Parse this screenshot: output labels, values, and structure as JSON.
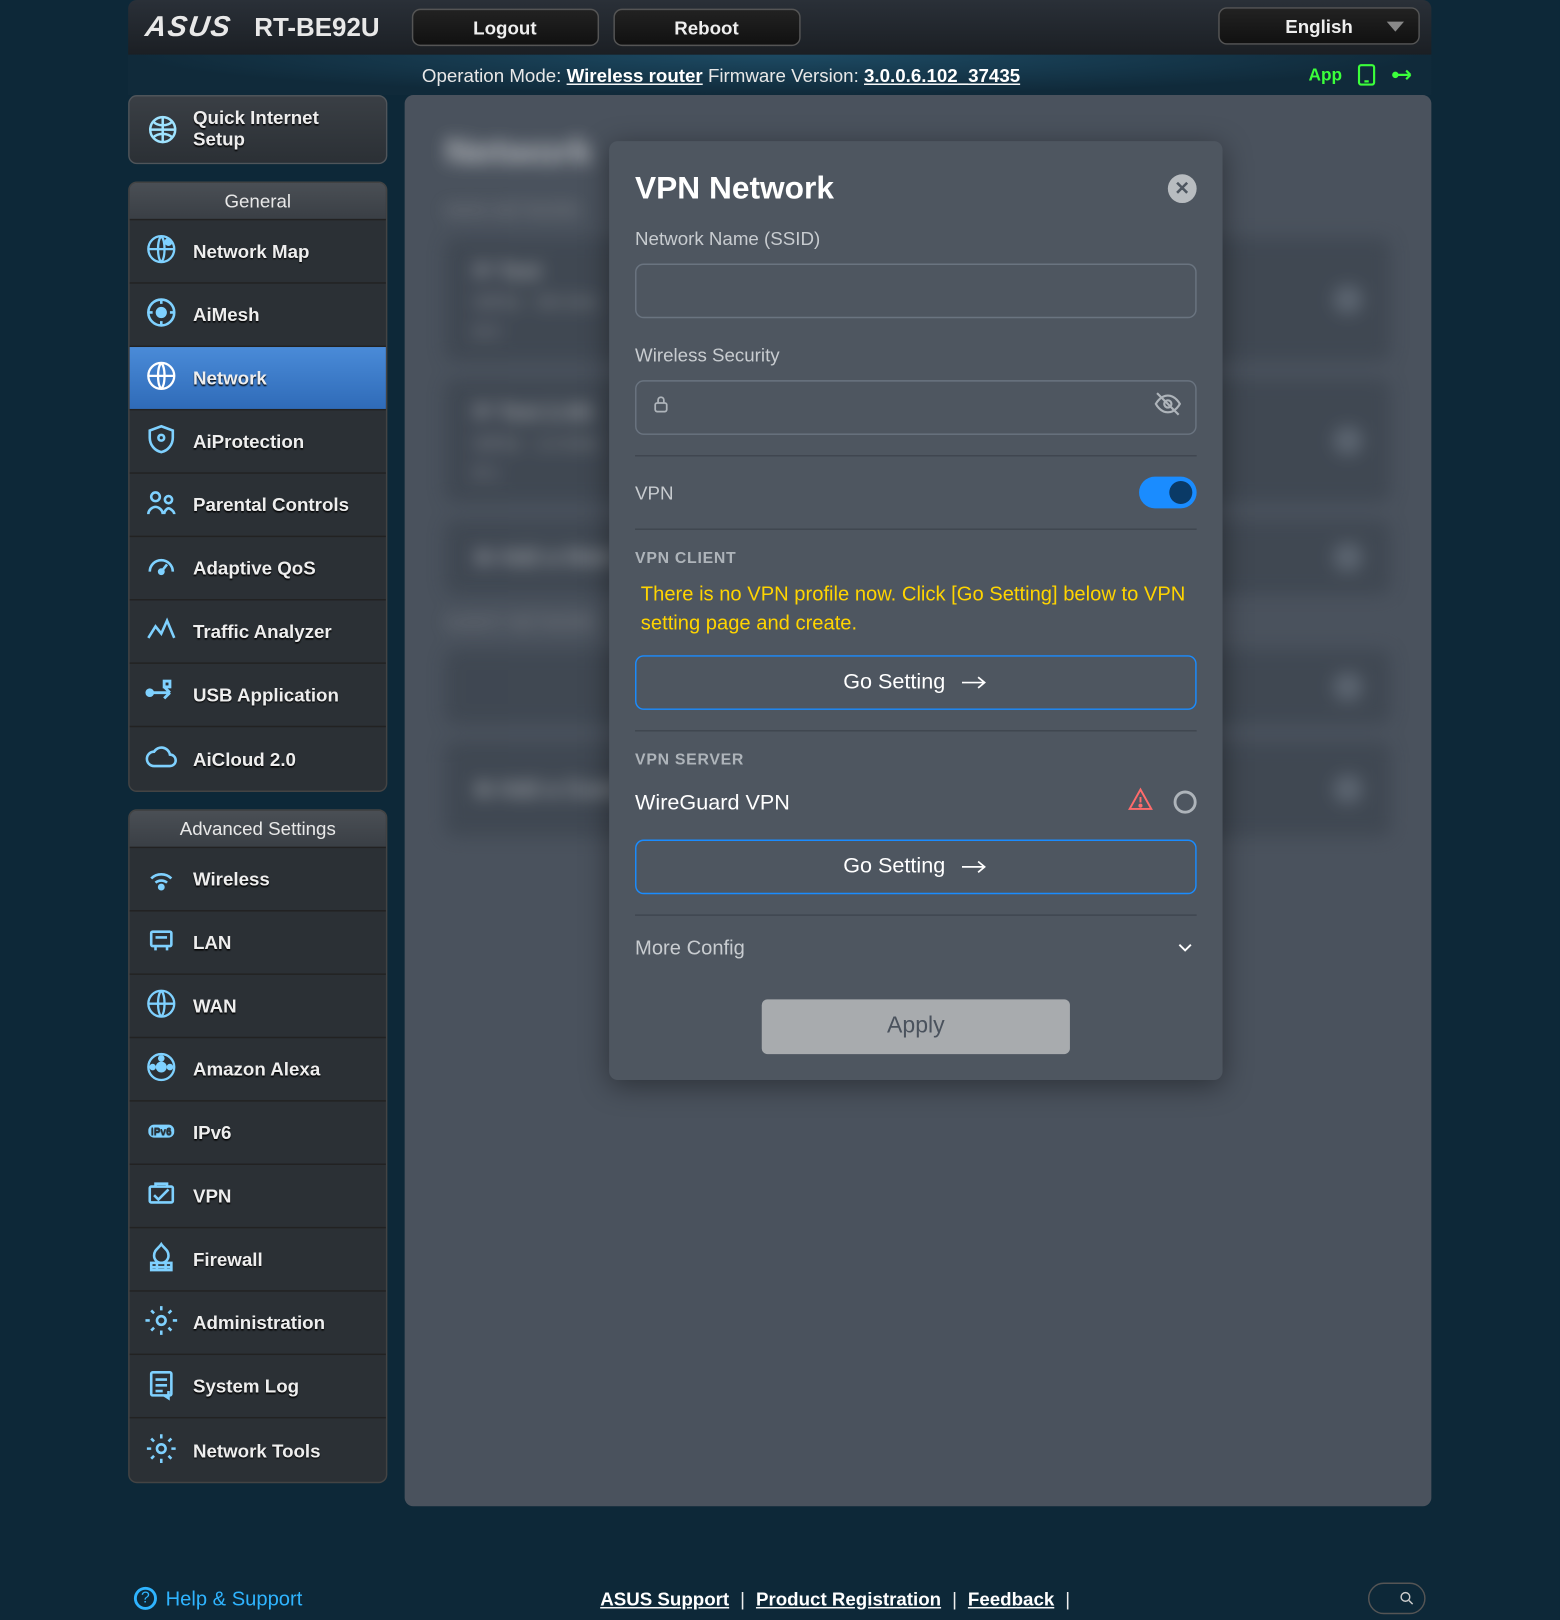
{
  "brand": {
    "vendor": "ASUS",
    "model": "RT-BE92U"
  },
  "top": {
    "logout": "Logout",
    "reboot": "Reboot",
    "language": "English"
  },
  "status": {
    "op_label": "Operation Mode:",
    "op_value": "Wireless router",
    "fw_label": "Firmware Version:",
    "fw_value": "3.0.0.6.102_37435",
    "app": "App"
  },
  "quick_setup": "Quick Internet Setup",
  "general_header": "General",
  "general_items": [
    {
      "label": "Network Map"
    },
    {
      "label": "AiMesh"
    },
    {
      "label": "Network",
      "active": true
    },
    {
      "label": "AiProtection"
    },
    {
      "label": "Parental Controls"
    },
    {
      "label": "Adaptive QoS"
    },
    {
      "label": "Traffic Analyzer"
    },
    {
      "label": "USB Application"
    },
    {
      "label": "AiCloud 2.0"
    }
  ],
  "adv_header": "Advanced Settings",
  "adv_items": [
    {
      "label": "Wireless"
    },
    {
      "label": "LAN"
    },
    {
      "label": "WAN"
    },
    {
      "label": "Amazon Alexa"
    },
    {
      "label": "IPv6"
    },
    {
      "label": "VPN"
    },
    {
      "label": "Firewall"
    },
    {
      "label": "Administration"
    },
    {
      "label": "System Log"
    },
    {
      "label": "Network Tools"
    }
  ],
  "bg_page": {
    "title": "Network",
    "sub1": "MAIN NETWORK"
  },
  "modal": {
    "title": "VPN Network",
    "ssid_label": "Network Name (SSID)",
    "ssid_value": "",
    "sec_label": "Wireless Security",
    "sec_value": "",
    "vpn_label": "VPN",
    "client_heading": "VPN CLIENT",
    "client_warn": "There is no VPN profile now. Click [Go Setting] below to VPN setting page and create.",
    "go_setting": "Go Setting",
    "server_heading": "VPN SERVER",
    "server_name": "WireGuard VPN",
    "more": "More Config",
    "apply": "Apply"
  },
  "footer": {
    "help": "Help & Support",
    "links": [
      "ASUS Support",
      "Product Registration",
      "Feedback"
    ]
  }
}
